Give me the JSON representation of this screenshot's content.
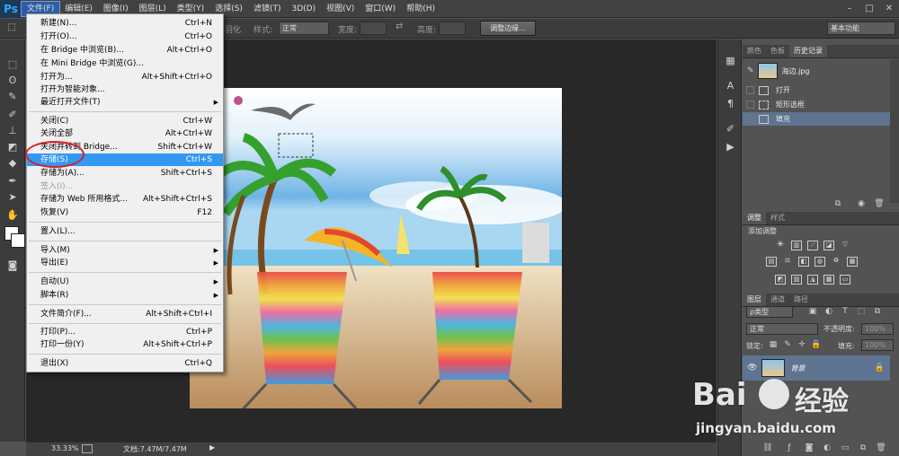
{
  "app": {
    "logo": "Ps"
  },
  "menubar": {
    "items": [
      "文件(F)",
      "编辑(E)",
      "图像(I)",
      "图层(L)",
      "类型(Y)",
      "选择(S)",
      "滤镜(T)",
      "3D(D)",
      "视图(V)",
      "窗口(W)",
      "帮助(H)"
    ],
    "active_index": 0
  },
  "options": {
    "feather_label": "羽化",
    "style_label": "样式:",
    "style_value": "正常",
    "width_label": "宽度:",
    "height_label": "高度:",
    "refine_button": "调整边缘...",
    "workspace": "基本功能"
  },
  "file_menu": {
    "items": [
      {
        "label": "新建(N)...",
        "shortcut": "Ctrl+N"
      },
      {
        "label": "打开(O)...",
        "shortcut": "Ctrl+O"
      },
      {
        "label": "在 Bridge 中浏览(B)...",
        "shortcut": "Alt+Ctrl+O"
      },
      {
        "label": "在 Mini Bridge 中浏览(G)...",
        "shortcut": ""
      },
      {
        "label": "打开为...",
        "shortcut": "Alt+Shift+Ctrl+O"
      },
      {
        "label": "打开为智能对象...",
        "shortcut": ""
      },
      {
        "label": "最近打开文件(T)",
        "shortcut": "",
        "submenu": true
      },
      {
        "label": "关闭(C)",
        "shortcut": "Ctrl+W"
      },
      {
        "label": "关闭全部",
        "shortcut": "Alt+Ctrl+W"
      },
      {
        "label": "关闭并转到 Bridge...",
        "shortcut": "Shift+Ctrl+W"
      },
      {
        "label": "存储(S)",
        "shortcut": "Ctrl+S",
        "highlighted": true
      },
      {
        "label": "存储为(A)...",
        "shortcut": "Shift+Ctrl+S"
      },
      {
        "label": "签入(I)...",
        "shortcut": "",
        "disabled": true
      },
      {
        "label": "存储为 Web 所用格式...",
        "shortcut": "Alt+Shift+Ctrl+S"
      },
      {
        "label": "恢复(V)",
        "shortcut": "F12"
      },
      {
        "label": "置入(L)...",
        "shortcut": ""
      },
      {
        "label": "导入(M)",
        "shortcut": "",
        "submenu": true
      },
      {
        "label": "导出(E)",
        "shortcut": "",
        "submenu": true
      },
      {
        "label": "自动(U)",
        "shortcut": "",
        "submenu": true
      },
      {
        "label": "脚本(R)",
        "shortcut": "",
        "submenu": true
      },
      {
        "label": "文件简介(F)...",
        "shortcut": "Alt+Shift+Ctrl+I"
      },
      {
        "label": "打印(P)...",
        "shortcut": "Ctrl+P"
      },
      {
        "label": "打印一份(Y)",
        "shortcut": "Alt+Shift+Ctrl+P"
      },
      {
        "label": "退出(X)",
        "shortcut": "Ctrl+Q"
      }
    ]
  },
  "status": {
    "zoom": "33.33%",
    "doc": "文档:7.47M/7.47M"
  },
  "panels": {
    "top_tabs": [
      "颜色",
      "色板",
      "历史记录"
    ],
    "history": {
      "snapshot": "海边.jpg",
      "states": [
        "打开",
        "矩形选框",
        "填充"
      ]
    },
    "adjust_tabs": [
      "调整",
      "样式"
    ],
    "adjust_title": "添加调整",
    "layers_tabs": [
      "图层",
      "通道",
      "路径"
    ],
    "kind_label": "ρ类型",
    "blend_mode": "正常",
    "opacity_label": "不透明度:",
    "opacity_value": "100%",
    "lock_label": "锁定:",
    "fill_label": "填充:",
    "fill_value": "100%",
    "layer_name": "背景"
  },
  "watermark": {
    "brand_left": "Bai",
    "brand_right": "经验",
    "url": "jingyan.baidu.com"
  },
  "colors": {
    "menu_highlight": "#3398f2",
    "callout": "#d2232a",
    "history_selected": "#5e7491"
  }
}
